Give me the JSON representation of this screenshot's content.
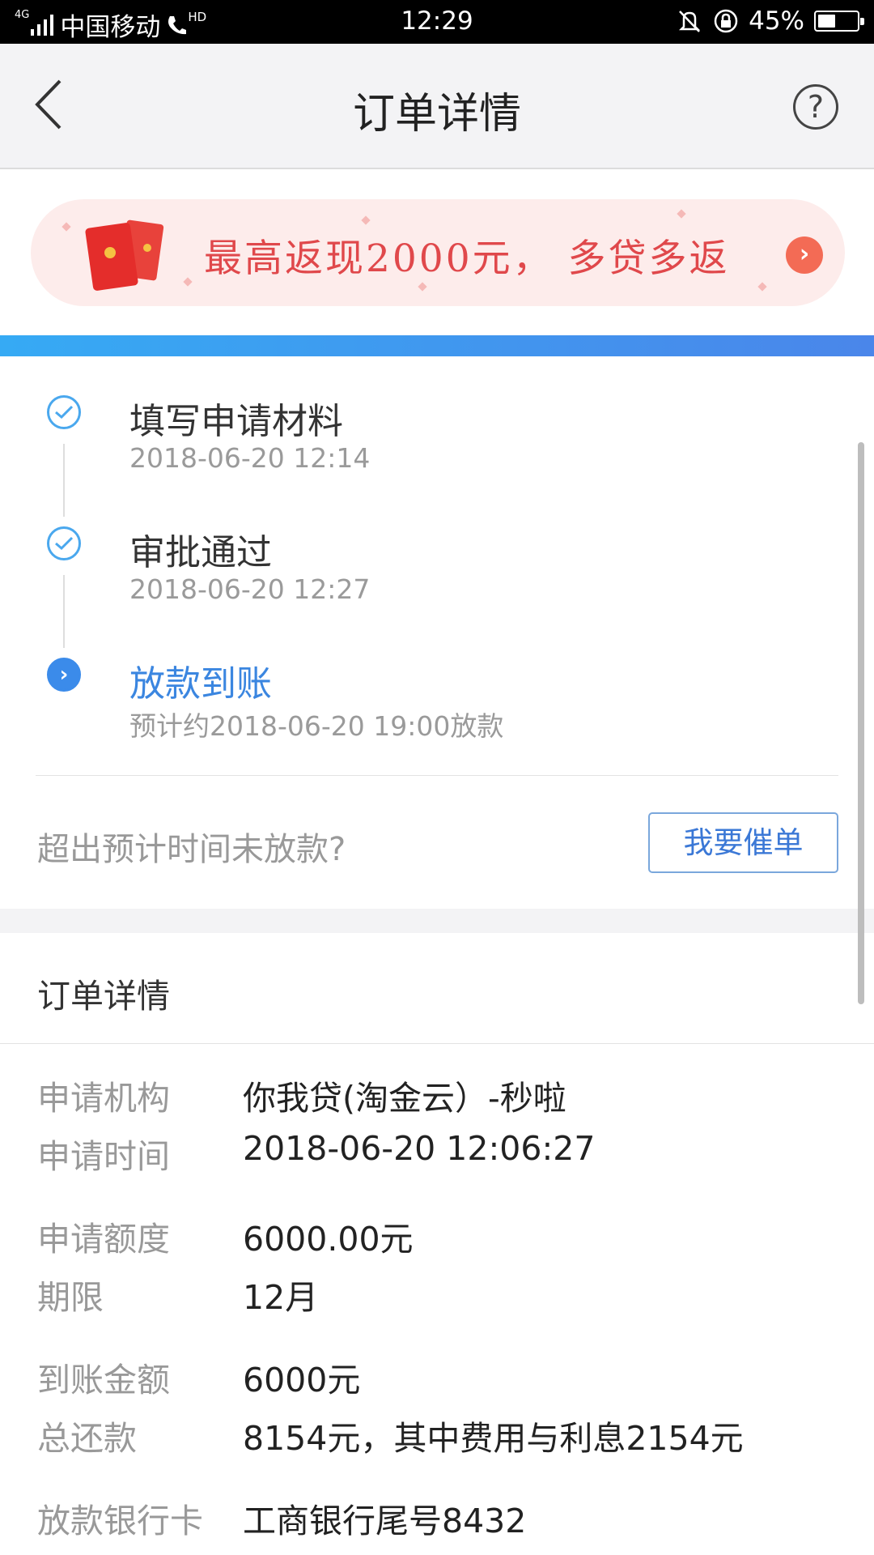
{
  "status_bar": {
    "network": "4G",
    "carrier": "中国移动",
    "hd": "HD",
    "time": "12:29",
    "battery": "45%",
    "battery_level": 0.45
  },
  "nav": {
    "title": "订单详情",
    "help_symbol": "?"
  },
  "promo": {
    "text": "最高返现2000元， 多贷多返"
  },
  "timeline": [
    {
      "title": "填写申请材料",
      "sub": "2018-06-20 12:14",
      "state": "done"
    },
    {
      "title": "审批通过",
      "sub": "2018-06-20 12:27",
      "state": "done"
    },
    {
      "title": "放款到账",
      "sub": "预计约2018-06-20 19:00放款",
      "state": "active"
    }
  ],
  "overdue": {
    "question": "超出预计时间未放款?",
    "button": "我要催单"
  },
  "details": {
    "title": "订单详情",
    "rows": [
      {
        "label": "申请机构",
        "value": "你我贷(淘金云）-秒啦"
      },
      {
        "label": "申请时间",
        "value": "2018-06-20 12:06:27"
      },
      {
        "label": "申请额度",
        "value": "6000.00元"
      },
      {
        "label": "期限",
        "value": "12月"
      },
      {
        "label": "到账金额",
        "value": "6000元"
      },
      {
        "label": "总还款",
        "value": "8154元，其中费用与利息2154元"
      },
      {
        "label": "放款银行卡",
        "value": "工商银行尾号8432"
      }
    ]
  },
  "colors": {
    "accent_blue": "#3b86e0",
    "promo_red": "#e0484b",
    "promo_bg": "#fdeceb"
  }
}
